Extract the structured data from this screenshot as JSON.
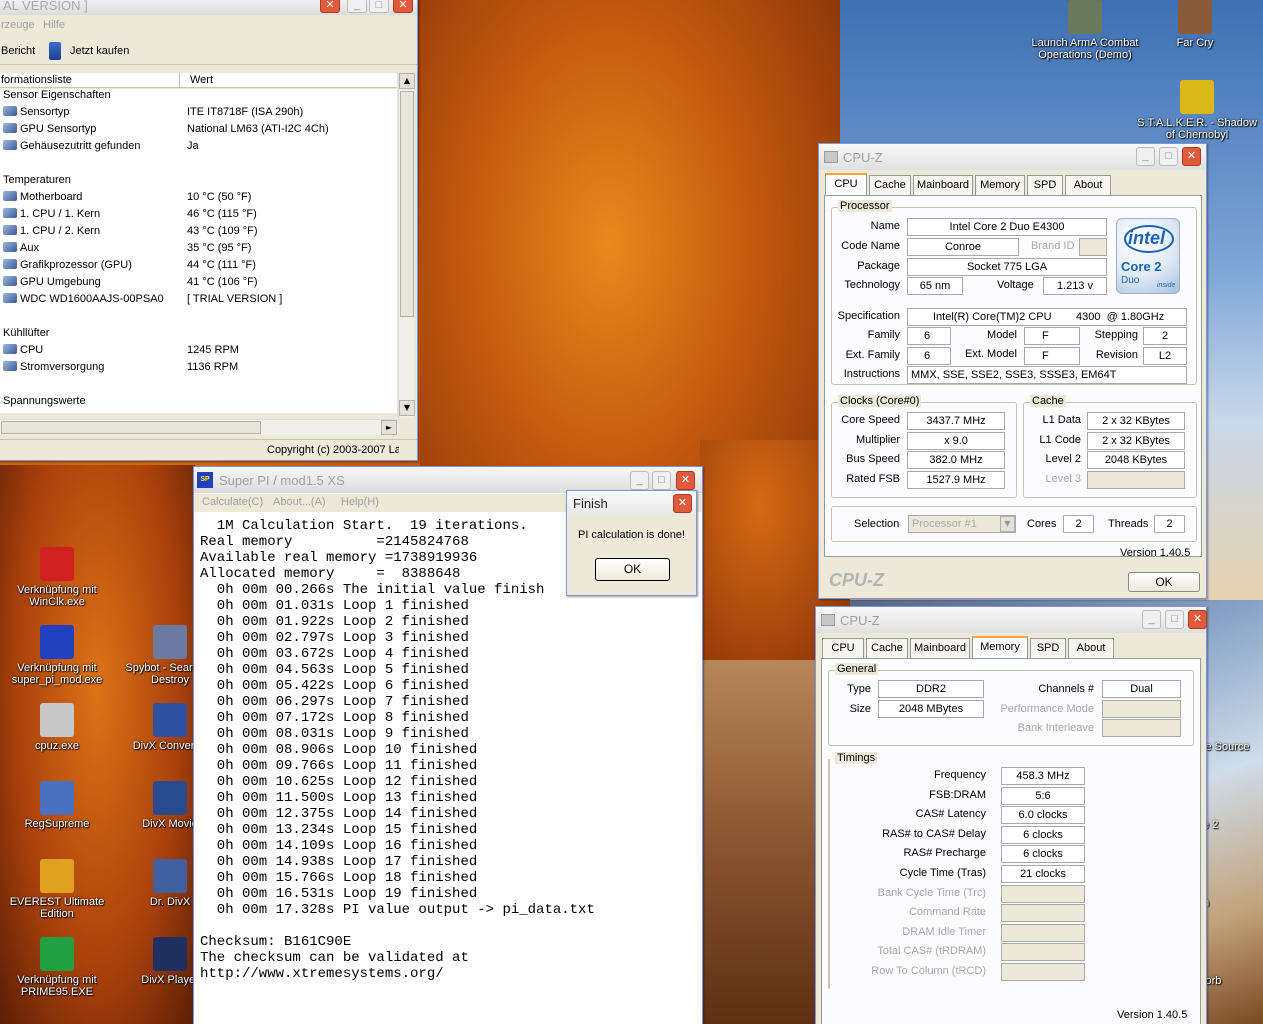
{
  "desktop": {
    "icons": [
      {
        "id": "arma",
        "label": "Launch ArmA Combat Operations (Demo)",
        "color": "#6b7a5a"
      },
      {
        "id": "farcry",
        "label": "Far Cry",
        "color": "#8a5a3a"
      },
      {
        "id": "stalker",
        "label": "S.T.A.L.K.E.R. - Shadow of Chernobyl",
        "color": "#d9b91a"
      },
      {
        "id": "ati",
        "label": "Verknüpfung mit WinClk.exe",
        "color": "#d02020"
      },
      {
        "id": "superpi",
        "label": "Verknüpfung mit super_pi_mod.exe",
        "color": "#2040c0"
      },
      {
        "id": "spybot",
        "label": "Spybot - Search & Destroy",
        "color": "#6a7aa0"
      },
      {
        "id": "cpuz",
        "label": "cpuz.exe",
        "color": "#c8c8c8"
      },
      {
        "id": "divxconv",
        "label": "DivX Converter",
        "color": "#3050a0"
      },
      {
        "id": "regsupreme",
        "label": "RegSupreme",
        "color": "#4a70c0"
      },
      {
        "id": "divxmovie",
        "label": "DivX Movie",
        "color": "#2a4a90"
      },
      {
        "id": "everest",
        "label": "EVEREST Ultimate Edition",
        "color": "#e0a020"
      },
      {
        "id": "drdivx",
        "label": "Dr. DivX",
        "color": "#4060a0"
      },
      {
        "id": "prime95",
        "label": "Verknüpfung mit PRIME95.EXE",
        "color": "#20a040"
      },
      {
        "id": "divxplayer",
        "label": "DivX Player",
        "color": "#203060"
      }
    ],
    "partial_labels": [
      "06",
      "ke Source",
      "fe 2",
      "m",
      "corb"
    ]
  },
  "everest": {
    "title": "AL VERSION ]",
    "menu": [
      "rzeuge",
      "Hilfe"
    ],
    "toolbar": {
      "report": "Bericht",
      "buy": "Jetzt kaufen"
    },
    "columns": {
      "name": "formationsliste",
      "value": "Wert"
    },
    "rows": [
      {
        "type": "section",
        "name": "Sensor Eigenschaften",
        "value": ""
      },
      {
        "type": "item",
        "name": "Sensortyp",
        "value": "ITE IT8718F  (ISA 290h)"
      },
      {
        "type": "item",
        "name": "GPU Sensortyp",
        "value": "National LM63  (ATI-I2C 4Ch)"
      },
      {
        "type": "item",
        "name": "Gehäusezutritt gefunden",
        "value": "Ja"
      },
      {
        "type": "blank",
        "name": "",
        "value": ""
      },
      {
        "type": "section",
        "name": "Temperaturen",
        "value": ""
      },
      {
        "type": "item",
        "name": "Motherboard",
        "value": "10 °C  (50 °F)"
      },
      {
        "type": "item",
        "name": "1. CPU / 1. Kern",
        "value": "46 °C  (115 °F)"
      },
      {
        "type": "item",
        "name": "1. CPU / 2. Kern",
        "value": "43 °C  (109 °F)"
      },
      {
        "type": "item",
        "name": "Aux",
        "value": "35 °C  (95 °F)"
      },
      {
        "type": "item",
        "name": "Grafikprozessor (GPU)",
        "value": "44 °C  (111 °F)"
      },
      {
        "type": "item",
        "name": "GPU Umgebung",
        "value": "41 °C  (106 °F)"
      },
      {
        "type": "item",
        "name": "WDC WD1600AAJS-00PSA0",
        "value": "[ TRIAL VERSION ]"
      },
      {
        "type": "blank",
        "name": "",
        "value": ""
      },
      {
        "type": "section",
        "name": "Kühllüfter",
        "value": ""
      },
      {
        "type": "item",
        "name": "CPU",
        "value": "1245 RPM"
      },
      {
        "type": "item",
        "name": "Stromversorgung",
        "value": "1136 RPM"
      },
      {
        "type": "blank",
        "name": "",
        "value": ""
      },
      {
        "type": "section",
        "name": "Spannungswerte",
        "value": ""
      }
    ],
    "status": "Copyright (c) 2003-2007 La"
  },
  "superpi": {
    "title": "Super PI / mod1.5 XS",
    "menu": [
      "Calculate(C)",
      "About...(A)",
      "Help(H)"
    ],
    "lines": [
      "  1M Calculation Start.  19 iterations.",
      "Real memory          =2145824768",
      "Available real memory =1738919936",
      "Allocated memory     =  8388648",
      "  0h 00m 00.266s The initial value finish",
      "  0h 00m 01.031s Loop 1 finished",
      "  0h 00m 01.922s Loop 2 finished",
      "  0h 00m 02.797s Loop 3 finished",
      "  0h 00m 03.672s Loop 4 finished",
      "  0h 00m 04.563s Loop 5 finished",
      "  0h 00m 05.422s Loop 6 finished",
      "  0h 00m 06.297s Loop 7 finished",
      "  0h 00m 07.172s Loop 8 finished",
      "  0h 00m 08.031s Loop 9 finished",
      "  0h 00m 08.906s Loop 10 finished",
      "  0h 00m 09.766s Loop 11 finished",
      "  0h 00m 10.625s Loop 12 finished",
      "  0h 00m 11.500s Loop 13 finished",
      "  0h 00m 12.375s Loop 14 finished",
      "  0h 00m 13.234s Loop 15 finished",
      "  0h 00m 14.109s Loop 16 finished",
      "  0h 00m 14.938s Loop 17 finished",
      "  0h 00m 15.766s Loop 18 finished",
      "  0h 00m 16.531s Loop 19 finished",
      "  0h 00m 17.328s PI value output -> pi_data.txt",
      "",
      "Checksum: B161C90E",
      "The checksum can be validated at",
      "http://www.xtremesystems.org/"
    ]
  },
  "finish": {
    "title": "Finish",
    "message": "PI calculation is done!",
    "ok": "OK"
  },
  "cpuz1": {
    "title": "CPU-Z",
    "tabs": [
      "CPU",
      "Cache",
      "Mainboard",
      "Memory",
      "SPD",
      "About"
    ],
    "active_tab": "CPU",
    "processor_group": "Processor",
    "labels": {
      "name": "Name",
      "codename": "Code Name",
      "brandid": "Brand ID",
      "package": "Package",
      "technology": "Technology",
      "voltage": "Voltage",
      "spec": "Specification",
      "family": "Family",
      "model": "Model",
      "stepping": "Stepping",
      "extfamily": "Ext. Family",
      "extmodel": "Ext. Model",
      "revision": "Revision",
      "instructions": "Instructions"
    },
    "values": {
      "name": "Intel Core 2 Duo E4300",
      "codename": "Conroe",
      "brandid": "",
      "package": "Socket 775 LGA",
      "technology": "65 nm",
      "voltage": "1.213 v",
      "spec": "Intel(R) Core(TM)2 CPU        4300  @ 1.80GHz",
      "family": "6",
      "model": "F",
      "stepping": "2",
      "extfamily": "6",
      "extmodel": "F",
      "revision": "L2",
      "instructions": "MMX, SSE, SSE2, SSE3, SSSE3, EM64T"
    },
    "logo": {
      "brand": "intel",
      "line1": "Core 2",
      "line2": "Duo",
      "tag": "inside"
    },
    "clocks_group": "Clocks (Core#0)",
    "clocks": [
      {
        "label": "Core Speed",
        "value": "3437.7 MHz"
      },
      {
        "label": "Multiplier",
        "value": "x 9.0"
      },
      {
        "label": "Bus Speed",
        "value": "382.0 MHz"
      },
      {
        "label": "Rated FSB",
        "value": "1527.9 MHz"
      }
    ],
    "cache_group": "Cache",
    "cache": [
      {
        "label": "L1 Data",
        "value": "2 x 32 KBytes"
      },
      {
        "label": "L1 Code",
        "value": "2 x 32 KBytes"
      },
      {
        "label": "Level 2",
        "value": "2048 KBytes"
      },
      {
        "label": "Level 3",
        "value": ""
      }
    ],
    "selection_label": "Selection",
    "selection_value": "Processor #1",
    "cores_label": "Cores",
    "cores": "2",
    "threads_label": "Threads",
    "threads": "2",
    "version": "Version 1.40.5",
    "brand": "CPU-Z",
    "ok": "OK"
  },
  "cpuz2": {
    "title": "CPU-Z",
    "tabs": [
      "CPU",
      "Cache",
      "Mainboard",
      "Memory",
      "SPD",
      "About"
    ],
    "active_tab": "Memory",
    "general_group": "General",
    "type_label": "Type",
    "type": "DDR2",
    "size_label": "Size",
    "size": "2048 MBytes",
    "channels_label": "Channels #",
    "channels": "Dual",
    "perfmode_label": "Performance Mode",
    "bankinter_label": "Bank Interleave",
    "timings_group": "Timings",
    "timings": [
      {
        "label": "Frequency",
        "value": "458.3 MHz",
        "dim": false
      },
      {
        "label": "FSB:DRAM",
        "value": "5:6",
        "dim": false
      },
      {
        "label": "CAS# Latency",
        "value": "6.0 clocks",
        "dim": false
      },
      {
        "label": "RAS# to CAS# Delay",
        "value": "6 clocks",
        "dim": false
      },
      {
        "label": "RAS# Precharge",
        "value": "6 clocks",
        "dim": false
      },
      {
        "label": "Cycle Time (Tras)",
        "value": "21 clocks",
        "dim": false
      },
      {
        "label": "Bank Cycle Time (Trc)",
        "value": "",
        "dim": true
      },
      {
        "label": "Command Rate",
        "value": "",
        "dim": true
      },
      {
        "label": "DRAM Idle Timer",
        "value": "",
        "dim": true
      },
      {
        "label": "Total CAS# (tRDRAM)",
        "value": "",
        "dim": true
      },
      {
        "label": "Row To Column (tRCD)",
        "value": "",
        "dim": true
      }
    ],
    "version": "Version 1.40.5"
  }
}
